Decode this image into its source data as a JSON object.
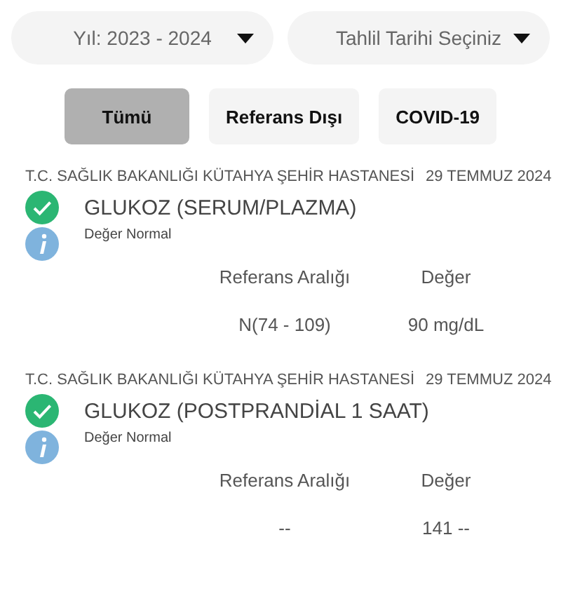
{
  "dropdowns": [
    {
      "value": "Yıl: 2023 - 2024"
    },
    {
      "value": "Tahlil Tarihi Seçiniz"
    }
  ],
  "filters": [
    {
      "label": "Tümü",
      "selected": true
    },
    {
      "label": "Referans Dışı",
      "selected": false
    },
    {
      "label": "COVID-19",
      "selected": false
    }
  ],
  "results": [
    {
      "hospital": "T.C. SAĞLIK BAKANLIĞI KÜTAHYA ŞEHİR HASTANESİ",
      "date": "29 TEMMUZ 2024",
      "test": "GLUKOZ (SERUM/PLAZMA)",
      "status": "Değer Normal",
      "range_label": "Referans Aralığı",
      "value_label": "Değer",
      "range": "N(74 - 109)",
      "value": "90 mg/dL"
    },
    {
      "hospital": "T.C. SAĞLIK BAKANLIĞI KÜTAHYA ŞEHİR HASTANESİ",
      "date": "29 TEMMUZ 2024",
      "test": "GLUKOZ (POSTPRANDİAL 1 SAAT)",
      "status": "Değer Normal",
      "range_label": "Referans Aralığı",
      "value_label": "Değer",
      "range": "--",
      "value": "141 --"
    }
  ]
}
